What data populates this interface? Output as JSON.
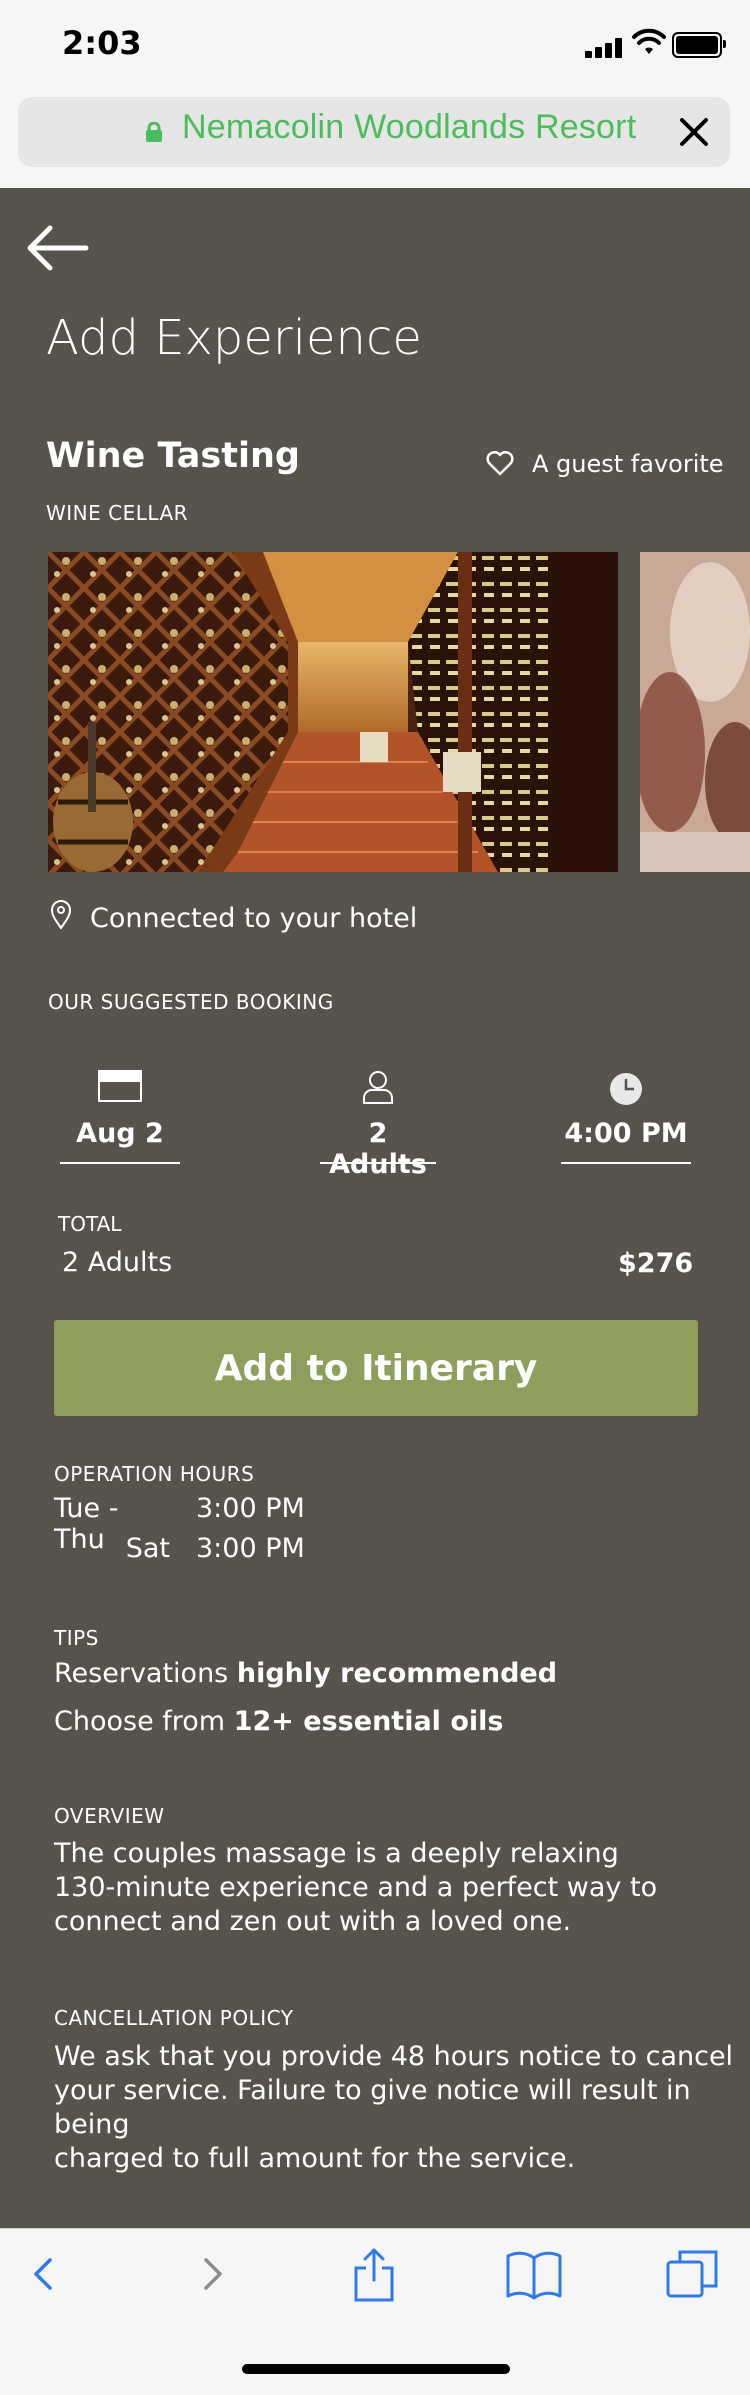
{
  "status_bar": {
    "time": "2:03"
  },
  "browser": {
    "url_title": "Nemacolin Woodlands Resort"
  },
  "page": {
    "title": "Add Experience",
    "experience_name": "Wine Tasting",
    "favorite_label": "A guest favorite",
    "category": "WINE CELLAR",
    "location_text": "Connected to your hotel",
    "suggested_label": "OUR SUGGESTED BOOKING",
    "booking": {
      "date": "Aug 2",
      "guests": "2 Adults",
      "time": "4:00 PM"
    },
    "total": {
      "label": "TOTAL",
      "guests": "2 Adults",
      "price": "$276"
    },
    "add_button": "Add to Itinerary",
    "hours": {
      "label": "OPERATION HOURS",
      "rows": [
        {
          "days": "Tue - Thu",
          "time": "3:00 PM"
        },
        {
          "days": "Sat",
          "time": "3:00 PM"
        }
      ]
    },
    "tips": {
      "label": "TIPS",
      "line1_prefix": "Reservations",
      "line1_bold": "highly recommended",
      "line2_prefix": "Choose from",
      "line2_bold": "12+ essential oils"
    },
    "overview": {
      "label": "OVERVIEW",
      "lines": [
        "The couples massage is a deeply relaxing",
        "130-minute experience and a perfect way to",
        "connect and zen out with a loved one."
      ]
    },
    "cancellation": {
      "label": "CANCELLATION POLICY",
      "lines": [
        "We ask that you provide 48 hours notice to cancel",
        "your service. Failure to give notice will result in being",
        "charged to full amount for the service."
      ]
    }
  },
  "colors": {
    "background": "#55534b",
    "button": "#909e5d",
    "url_green": "#4bbd5b",
    "toolbar_blue": "#2f7ae5"
  },
  "icons": [
    "back-arrow-icon",
    "lock-icon",
    "close-icon",
    "heart-icon",
    "location-pin-icon",
    "calendar-icon",
    "person-icon",
    "clock-icon",
    "share-icon",
    "bookmarks-icon",
    "tabs-icon"
  ]
}
